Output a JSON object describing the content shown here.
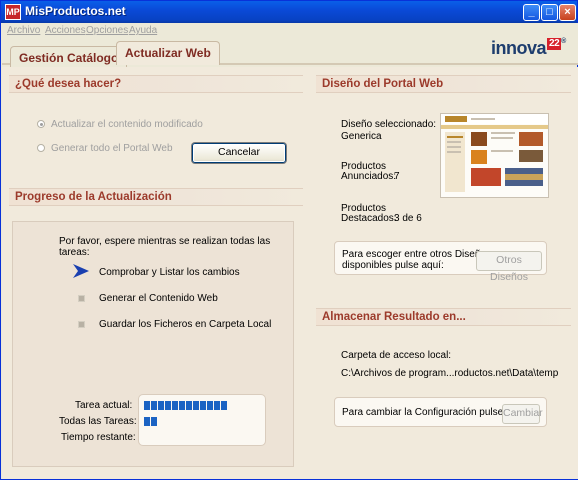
{
  "window": {
    "title": "MisProductos.net",
    "icon_text": "MP",
    "minimize_glyph": "_",
    "maximize_glyph": "□",
    "close_glyph": "×"
  },
  "menu": {
    "items": [
      {
        "label": "Archivo"
      },
      {
        "label": "Acciones"
      },
      {
        "label": "Opciones"
      },
      {
        "label": "Ayuda"
      }
    ]
  },
  "tabs": {
    "gestion": "Gestión Catálogo",
    "actualizar": "Actualizar Web"
  },
  "logo": {
    "text": "innova",
    "number": "22",
    "reg": "®"
  },
  "que_hacer": {
    "heading": "¿Qué desea hacer?",
    "option1": "Actualizar el contenido modificado",
    "option2": "Generar todo el Portal Web",
    "cancel_label": "Cancelar"
  },
  "progreso": {
    "heading": "Progreso de la Actualización",
    "message": "Por favor, espere mientras se realizan todas las tareas:",
    "steps": [
      {
        "label": "Comprobar y Listar los cambios"
      },
      {
        "label": "Generar el Contenido Web"
      },
      {
        "label": "Guardar los Ficheros en Carpeta Local"
      }
    ],
    "tarea_actual": "Tarea actual:",
    "todas_tareas": "Todas las Tareas:",
    "tiempo_restante": "Tiempo restante:",
    "tarea_actual_blocks": 12,
    "todas_tareas_blocks": 2
  },
  "diseno": {
    "heading": "Diseño del Portal Web",
    "seleccionado_label": "Diseño seleccionado:",
    "seleccionado_value": "Generica",
    "anunciados_label_1": "Productos",
    "anunciados_label_2": "Anunciados:",
    "anunciados_value": "7",
    "destacados_label_1": "Productos",
    "destacados_label_2": "Destacados:",
    "destacados_value": "3 de 6",
    "choose_line1": "Para escoger entre otros Diseños",
    "choose_line2": "disponibles pulse aquí:",
    "otros_label": "Otros Diseños"
  },
  "almacenar": {
    "heading": "Almacenar Resultado en...",
    "carpeta_label": "Carpeta de acceso local:",
    "carpeta_path": "C:\\Archivos de program...roductos.net\\Data\\temp",
    "config_text": "Para cambiar la Configuración pulse aquí:",
    "cambiar_label": "Cambiar"
  }
}
